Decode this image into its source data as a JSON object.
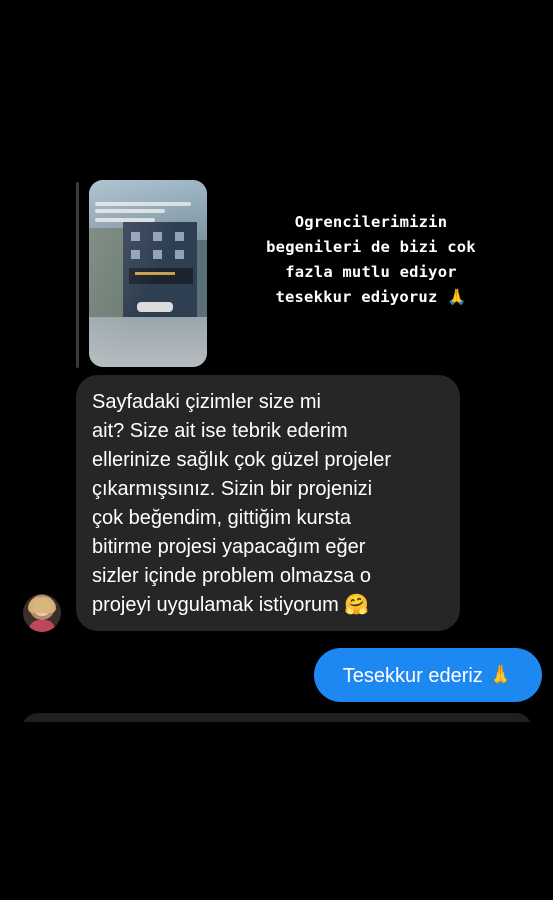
{
  "story_reply": {
    "caption_lines": [
      "Ogrencilerimizin",
      "begenileri de bizi cok",
      "fazla mutlu ediyor",
      "tesekkur ediyoruz"
    ],
    "caption_emoji": "🙏",
    "thumbnail_icon": "story-photo-thumbnail"
  },
  "incoming_message": {
    "text": "Sayfadaki çizimler size mi\nait? Size ait ise tebrik ederim\nellerinize sağlık çok güzel projeler\nçıkarmışsınız. Sizin bir projenizi\nçok beğendim, gittiğim kursta\nbitirme projesi yapacağım eğer\nsizler içinde problem olmazsa o\nprojeyi uygulamak istiyorum",
    "emoji": "🤗"
  },
  "outgoing_message": {
    "text": "Tesekkur ederiz",
    "emoji": "🙏"
  },
  "colors": {
    "background": "#000000",
    "incoming_bubble": "#262628",
    "outgoing_bubble": "#1e88f2"
  }
}
